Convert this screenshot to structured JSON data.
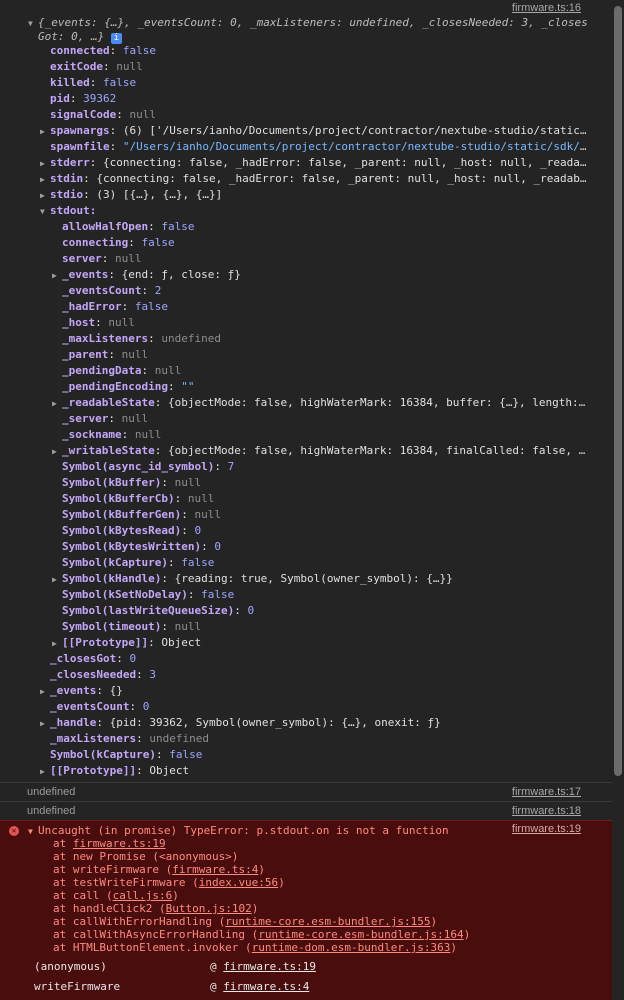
{
  "first_source": "firmware.ts:16",
  "object_summary": {
    "open_brace": "{",
    "events_key": "_events",
    "events_val": "{…}",
    "count_key": "_eventsCount",
    "count_val": "0",
    "max_key": "_maxListeners",
    "max_val": "undefined",
    "closes_key": "_closesNeeded",
    "closes_val": "3",
    "tail": "_closes",
    "line2": "Got: 0, …}",
    "info": "i"
  },
  "props": [
    {
      "k": "connected",
      "v": "false",
      "t": "bool"
    },
    {
      "k": "exitCode",
      "v": "null",
      "t": "null"
    },
    {
      "k": "killed",
      "v": "false",
      "t": "bool"
    },
    {
      "k": "pid",
      "v": "39362",
      "t": "num"
    },
    {
      "k": "signalCode",
      "v": "null",
      "t": "null"
    }
  ],
  "spawnargs": {
    "k": "spawnargs",
    "v": "(6) ['/Users/ianho/Documents/project/contractor/nextube-studio/static/sdk/bin…"
  },
  "spawnfile": {
    "k": "spawnfile",
    "v": "\"/Users/ianho/Documents/project/contractor/nextube-studio/static/sdk/bin/…"
  },
  "stderr": {
    "k": "stderr",
    "v": "{connecting: false, _hadError: false, _parent: null, _host: null, _readableState: …"
  },
  "stdin": {
    "k": "stdin",
    "v": "{connecting: false, _hadError: false, _parent: null, _host: null, _readableState: …"
  },
  "stdio": {
    "k": "stdio",
    "v": "(3) [{…}, {…}, {…}]"
  },
  "stdout_key": "stdout",
  "stdout_props": [
    {
      "k": "allowHalfOpen",
      "v": "false",
      "t": "bool",
      "exp": false
    },
    {
      "k": "connecting",
      "v": "false",
      "t": "bool",
      "exp": false
    },
    {
      "k": "server",
      "v": "null",
      "t": "null",
      "exp": false
    },
    {
      "k": "_events",
      "v": "{end: ƒ, close: ƒ}",
      "t": "plain",
      "exp": true
    },
    {
      "k": "_eventsCount",
      "v": "2",
      "t": "num",
      "exp": false
    },
    {
      "k": "_hadError",
      "v": "false",
      "t": "bool",
      "exp": false
    },
    {
      "k": "_host",
      "v": "null",
      "t": "null",
      "exp": false
    },
    {
      "k": "_maxListeners",
      "v": "undefined",
      "t": "null",
      "exp": false
    },
    {
      "k": "_parent",
      "v": "null",
      "t": "null",
      "exp": false
    },
    {
      "k": "_pendingData",
      "v": "null",
      "t": "null",
      "exp": false
    },
    {
      "k": "_pendingEncoding",
      "v": "\"\"",
      "t": "str",
      "exp": false
    },
    {
      "k": "_readableState",
      "v": "{objectMode: false, highWaterMark: 16384, buffer: {…}, length: 0, pipes: …",
      "t": "plain",
      "exp": true
    },
    {
      "k": "_server",
      "v": "null",
      "t": "null",
      "exp": false
    },
    {
      "k": "_sockname",
      "v": "null",
      "t": "null",
      "exp": false
    },
    {
      "k": "_writableState",
      "v": "{objectMode: false, highWaterMark: 16384, finalCalled: false, needDrain: …",
      "t": "plain",
      "exp": true
    },
    {
      "k": "Symbol(async_id_symbol)",
      "v": "7",
      "t": "num",
      "exp": false
    },
    {
      "k": "Symbol(kBuffer)",
      "v": "null",
      "t": "null",
      "exp": false
    },
    {
      "k": "Symbol(kBufferCb)",
      "v": "null",
      "t": "null",
      "exp": false
    },
    {
      "k": "Symbol(kBufferGen)",
      "v": "null",
      "t": "null",
      "exp": false
    },
    {
      "k": "Symbol(kBytesRead)",
      "v": "0",
      "t": "num",
      "exp": false
    },
    {
      "k": "Symbol(kBytesWritten)",
      "v": "0",
      "t": "num",
      "exp": false
    },
    {
      "k": "Symbol(kCapture)",
      "v": "false",
      "t": "bool",
      "exp": false
    },
    {
      "k": "Symbol(kHandle)",
      "v": "{reading: true, Symbol(owner_symbol): {…}}",
      "t": "plain",
      "exp": true
    },
    {
      "k": "Symbol(kSetNoDelay)",
      "v": "false",
      "t": "bool",
      "exp": false
    },
    {
      "k": "Symbol(lastWriteQueueSize)",
      "v": "0",
      "t": "num",
      "exp": false
    },
    {
      "k": "Symbol(timeout)",
      "v": "null",
      "t": "null",
      "exp": false
    },
    {
      "k": "[[Prototype]]",
      "v": "Object",
      "t": "plain",
      "exp": true
    }
  ],
  "tail_props": [
    {
      "k": "_closesGot",
      "v": "0",
      "t": "num",
      "exp": false
    },
    {
      "k": "_closesNeeded",
      "v": "3",
      "t": "num",
      "exp": false
    },
    {
      "k": "_events",
      "v": "{}",
      "t": "plain",
      "exp": true
    },
    {
      "k": "_eventsCount",
      "v": "0",
      "t": "num",
      "exp": false
    },
    {
      "k": "_handle",
      "v": "{pid: 39362, Symbol(owner_symbol): {…}, onexit: ƒ}",
      "t": "plain",
      "exp": true
    },
    {
      "k": "_maxListeners",
      "v": "undefined",
      "t": "null",
      "exp": false
    },
    {
      "k": "Symbol(kCapture)",
      "v": "false",
      "t": "bool",
      "exp": false
    },
    {
      "k": "[[Prototype]]",
      "v": "Object",
      "t": "plain",
      "exp": true
    }
  ],
  "messages": [
    {
      "text": "undefined",
      "src": "firmware.ts:17"
    },
    {
      "text": "undefined",
      "src": "firmware.ts:18"
    }
  ],
  "error": {
    "title": "Uncaught (in promise) TypeError: p.stdout.on is not a function",
    "src": "firmware.ts:19",
    "stack": [
      {
        "pre": "at ",
        "link": "firmware.ts:19",
        "post": ""
      },
      {
        "pre": "at new Promise (<anonymous>)",
        "link": "",
        "post": ""
      },
      {
        "pre": "at writeFirmware (",
        "link": "firmware.ts:4",
        "post": ")"
      },
      {
        "pre": "at testWriteFirmware (",
        "link": "index.vue:56",
        "post": ")"
      },
      {
        "pre": "at call (",
        "link": "call.js:6",
        "post": ")"
      },
      {
        "pre": "at handleClick2 (",
        "link": "Button.js:102",
        "post": ")"
      },
      {
        "pre": "at callWithErrorHandling (",
        "link": "runtime-core.esm-bundler.js:155",
        "post": ")"
      },
      {
        "pre": "at callWithAsyncErrorHandling (",
        "link": "runtime-core.esm-bundler.js:164",
        "post": ")"
      },
      {
        "pre": "at HTMLButtonElement.invoker (",
        "link": "runtime-dom.esm-bundler.js:363",
        "post": ")"
      }
    ],
    "async_stack": [
      {
        "fn": "(anonymous)",
        "link": "firmware.ts:19"
      },
      {
        "fn": "writeFirmware",
        "link": "firmware.ts:4"
      }
    ]
  }
}
